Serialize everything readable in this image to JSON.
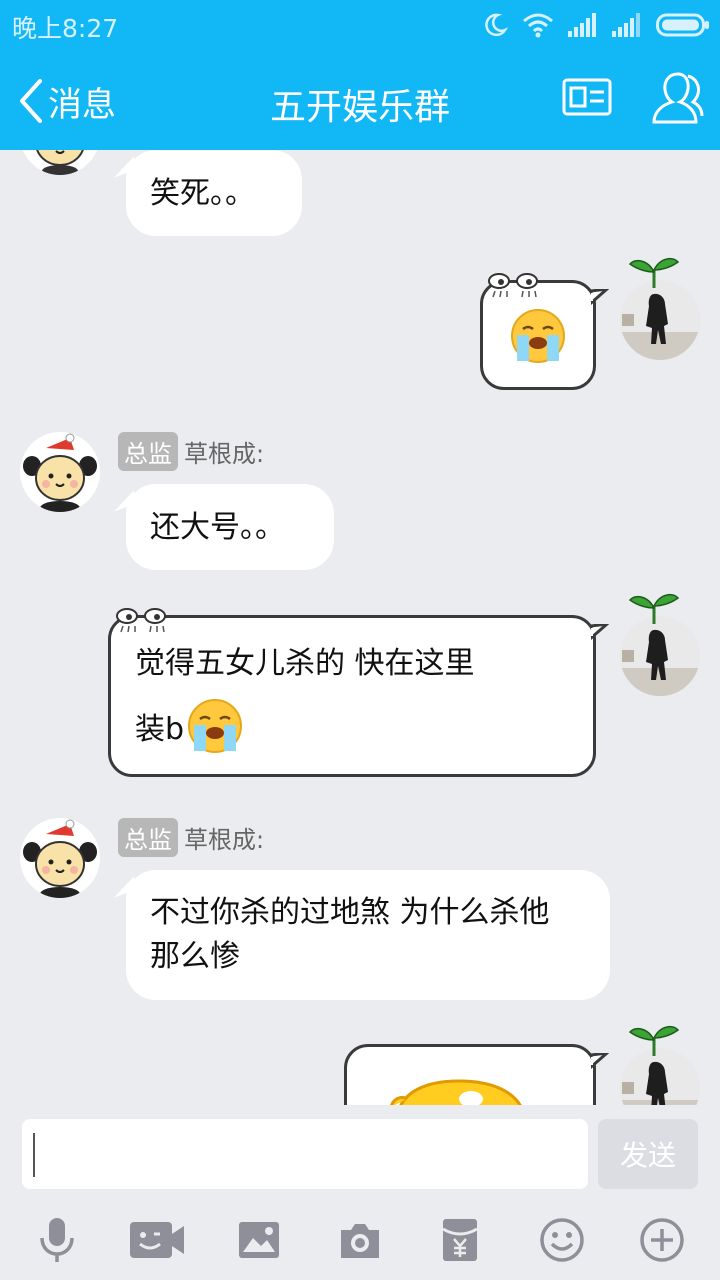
{
  "status_bar": {
    "time": "晚上8:27"
  },
  "header": {
    "back_label": "消息",
    "title": "五开娱乐群"
  },
  "messages": {
    "m1": {
      "text": "笑死。。"
    },
    "m3": {
      "badge": "总监",
      "sender": "草根成:",
      "text": "还大号。。"
    },
    "m4": {
      "line1": "觉得五女儿杀的 快在这里",
      "line2": "装b"
    },
    "m5": {
      "badge": "总监",
      "sender": "草根成:",
      "line1": "不过你杀的过地煞 为什么杀他",
      "line2": "那么惨"
    }
  },
  "input": {
    "value": "",
    "send_label": "发送"
  },
  "toolbar": {
    "icons": [
      "microphone-icon",
      "video-call-icon",
      "image-icon",
      "camera-icon",
      "red-packet-icon",
      "emoji-icon",
      "plus-icon"
    ]
  },
  "colors": {
    "header": "#12b7f5",
    "background": "#ebecf0",
    "icon_gray": "#8e8f98"
  }
}
